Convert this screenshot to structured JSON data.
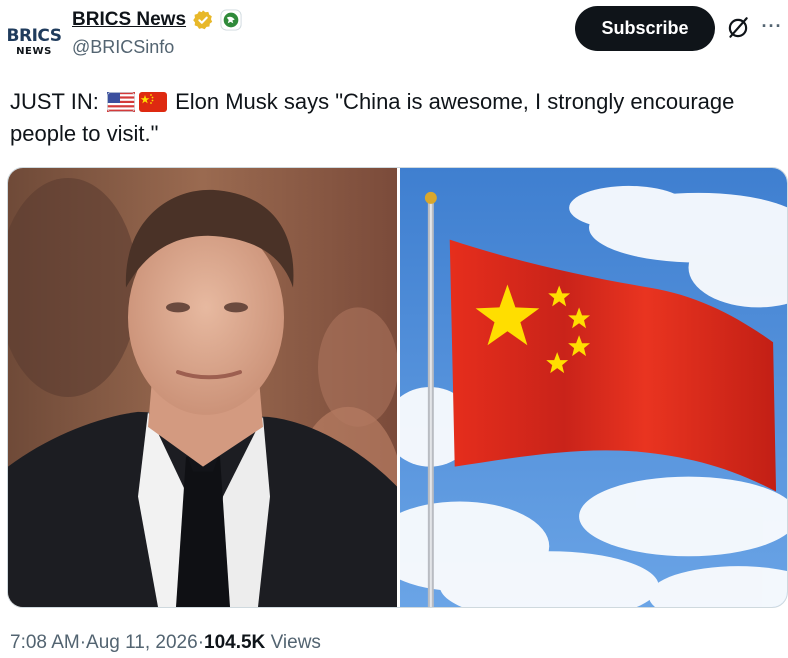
{
  "account": {
    "avatar_top": "BRICS",
    "avatar_bottom": "NEWS",
    "display_name": "BRICS News",
    "handle": "@BRICSinfo"
  },
  "actions": {
    "subscribe_label": "Subscribe",
    "more_label": "···"
  },
  "tweet": {
    "text_prefix": "JUST IN:",
    "text_body": "Elon Musk says \"China is awesome, I strongly encourage people to visit.\""
  },
  "meta": {
    "time": "7:08 AM",
    "separator": " · ",
    "date": "Aug 11, 2026",
    "views_count": "104.5K",
    "views_label": "Views"
  },
  "icons": {
    "verified": "verified-badge-icon",
    "affiliate": "affiliate-badge-icon",
    "grok": "grok-icon",
    "more": "more-icon"
  },
  "colors": {
    "text": "#0f1419",
    "secondary": "#536471",
    "subscribe_bg": "#0f1419",
    "verified_gold": "#e8b829",
    "flag_red": "#de2910",
    "flag_yellow": "#ffde00",
    "sky": "#4f8fd8"
  }
}
